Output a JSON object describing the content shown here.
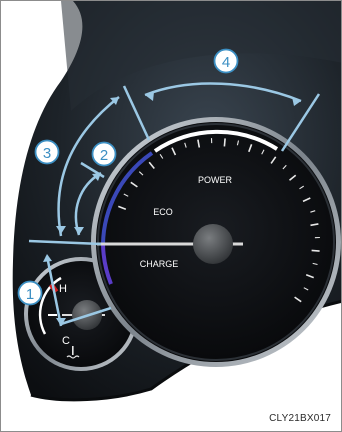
{
  "gauge": {
    "zone_power": "POWER",
    "zone_eco": "ECO",
    "zone_charge": "CHARGE"
  },
  "temp_gauge": {
    "hot_mark": "H",
    "cold_mark": "C"
  },
  "callouts": [
    {
      "number": "1"
    },
    {
      "number": "2"
    },
    {
      "number": "3"
    },
    {
      "number": "4"
    }
  ],
  "figure_code": "CLY21BX017",
  "colors": {
    "background": "#ffffff",
    "cluster_housing": "#1b2026",
    "gauge_face": "#0b0d10",
    "eco_arc": "#3a48b8",
    "charge_arc": "#5a3cc8",
    "power_arc": "#ffffff",
    "callout_line": "#9bc8e4",
    "callout_circle": "#3c8fc3",
    "red_mark": "#d21a1a"
  },
  "icons": [
    "coolant-temperature-icon"
  ]
}
